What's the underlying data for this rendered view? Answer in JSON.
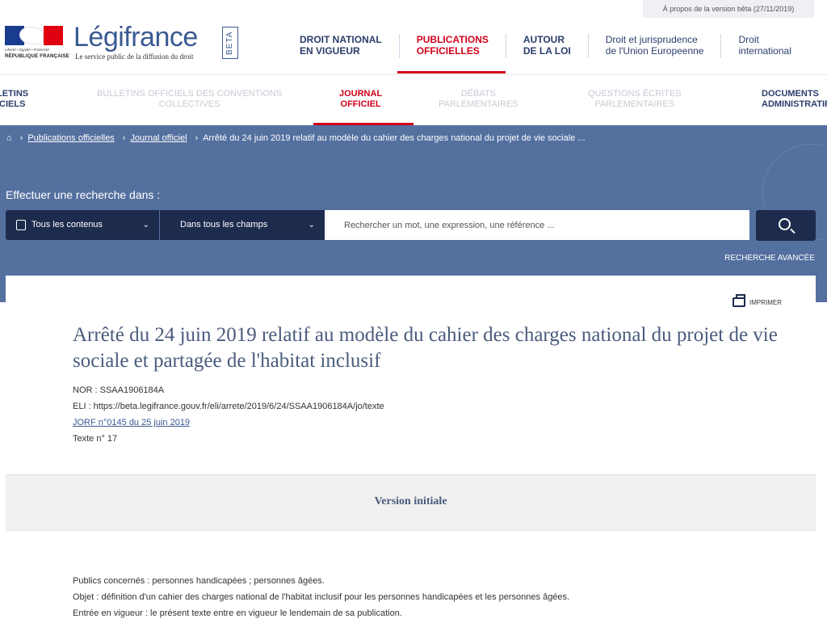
{
  "beta_bar": "À propos de la version bêta (27/11/2019)",
  "logo": {
    "rf_motto": "Liberté • Égalité • Fraternité",
    "rf_name": "RÉPUBLIQUE FRANÇAISE",
    "name": "Légifrance",
    "subtitle": "Le service public de la diffusion du droit",
    "beta": "BETA"
  },
  "main_nav": [
    {
      "label": "DROIT NATIONAL\nEN VIGUEUR"
    },
    {
      "label": "PUBLICATIONS\nOFFICIELLES"
    },
    {
      "label": "AUTOUR\nDE LA LOI"
    },
    {
      "label": "Droit et jurisprudence\nde l'Union Europeenne"
    },
    {
      "label": "Droit\ninternational"
    }
  ],
  "sub_nav": [
    {
      "label": "LETINS\nICIELS"
    },
    {
      "label": "BULLETINS OFFICIELS DES CONVENTIONS\nCOLLECTIVES"
    },
    {
      "label": "JOURNAL\nOFFICIEL"
    },
    {
      "label": "DÉBATS\nPARLEMENTAIRES"
    },
    {
      "label": "QUESTIONS ÉCRITES\nPARLEMENTAIRES"
    },
    {
      "label": "DOCUMENTS\nADMINISTRATIF"
    }
  ],
  "breadcrumb": {
    "home_icon": "home-icon",
    "items": [
      "Publications officielles",
      "Journal officiel",
      "Arrêté du 24 juin 2019 relatif au modèle du cahier des charges national du projet de vie sociale ..."
    ]
  },
  "search": {
    "title": "Effectuer une recherche dans :",
    "scope": "Tous les contenus",
    "field": "Dans tous les champs",
    "placeholder": "Rechercher un mot, une expression, une référence ...",
    "advanced": "RECHERCHE AVANCÉE"
  },
  "document": {
    "print": "IMPRIMER",
    "title": "Arrêté du 24 juin 2019 relatif au modèle du cahier des charges national du projet de vie sociale et partagée de l'habitat inclusif",
    "nor": "NOR : SSAA1906184A",
    "eli": "ELI : https://beta.legifrance.gouv.fr/eli/arrete/2019/6/24/SSAA1906184A/jo/texte",
    "jorf": "JORF n°0145 du 25 juin 2019",
    "texte": "Texte n° 17",
    "version": "Version initiale",
    "body": [
      "Publics concernés : personnes handicapées ; personnes âgées.",
      "Objet : définition d'un cahier des charges national de l'habitat inclusif pour les personnes handicapées et les personnes âgées.",
      "Entrée en vigueur : le présent texte entre en vigueur le lendemain de sa publication."
    ]
  },
  "colors": {
    "accent": "#d0021b",
    "band": "#54709f",
    "navy": "#1d2b4d"
  }
}
